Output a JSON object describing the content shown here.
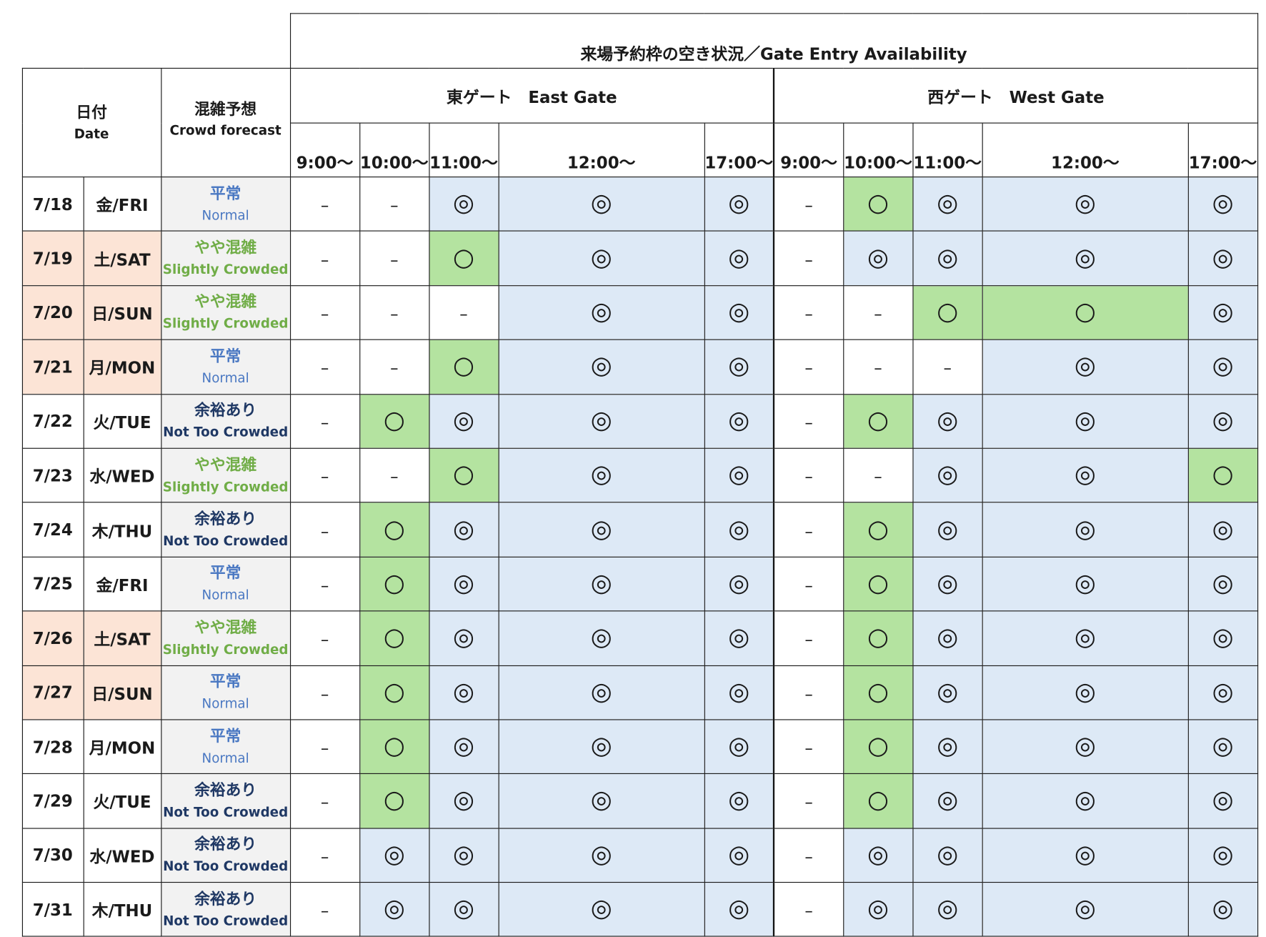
{
  "title": "来場予約枠の空き状況／Gate Entry Availability",
  "header": {
    "date_jp": "日付",
    "date_en": "Date",
    "forecast_jp": "混雑予想",
    "forecast_en": "Crowd forecast"
  },
  "gates": [
    {
      "label": "東ゲート　East Gate",
      "times": [
        "9:00〜",
        "10:00〜",
        "11:00〜",
        "12:00〜",
        "17:00〜"
      ]
    },
    {
      "label": "西ゲート　West Gate",
      "times": [
        "9:00〜",
        "10:00〜",
        "11:00〜",
        "12:00〜",
        "17:00〜"
      ]
    }
  ],
  "forecast_levels": {
    "normal": {
      "jp": "平常",
      "en": "Normal",
      "color": "#4a78c2"
    },
    "slightly": {
      "jp": "やや混雑",
      "en": "Slightly Crowded",
      "color": "#70ad47"
    },
    "notcrowded": {
      "jp": "余裕あり",
      "en": "Not Too Crowded",
      "color": "#1f3864"
    }
  },
  "symbols": {
    "available": {
      "mark": "◎",
      "bg": "#dde9f6"
    },
    "limited": {
      "mark": "○",
      "bg": "#b4e3a0"
    },
    "none": {
      "mark": "–",
      "bg": "#ffffff"
    }
  },
  "weekend_bg": "#fce4d6",
  "rows": [
    {
      "date": "7/18",
      "day": "金/FRI",
      "weekend": false,
      "forecast": "normal",
      "east": [
        "none",
        "none",
        "available",
        "available",
        "available"
      ],
      "west": [
        "none",
        "limited",
        "available",
        "available",
        "available"
      ]
    },
    {
      "date": "7/19",
      "day": "土/SAT",
      "weekend": true,
      "forecast": "slightly",
      "east": [
        "none",
        "none",
        "limited",
        "available",
        "available"
      ],
      "west": [
        "none",
        "available",
        "available",
        "available",
        "available"
      ]
    },
    {
      "date": "7/20",
      "day": "日/SUN",
      "weekend": true,
      "forecast": "slightly",
      "east": [
        "none",
        "none",
        "none",
        "available",
        "available"
      ],
      "west": [
        "none",
        "none",
        "limited",
        "limited",
        "available"
      ]
    },
    {
      "date": "7/21",
      "day": "月/MON",
      "weekend": true,
      "forecast": "normal",
      "east": [
        "none",
        "none",
        "limited",
        "available",
        "available"
      ],
      "west": [
        "none",
        "none",
        "none",
        "available",
        "available"
      ]
    },
    {
      "date": "7/22",
      "day": "火/TUE",
      "weekend": false,
      "forecast": "notcrowded",
      "east": [
        "none",
        "limited",
        "available",
        "available",
        "available"
      ],
      "west": [
        "none",
        "limited",
        "available",
        "available",
        "available"
      ]
    },
    {
      "date": "7/23",
      "day": "水/WED",
      "weekend": false,
      "forecast": "slightly",
      "east": [
        "none",
        "none",
        "limited",
        "available",
        "available"
      ],
      "west": [
        "none",
        "none",
        "available",
        "available",
        "limited"
      ]
    },
    {
      "date": "7/24",
      "day": "木/THU",
      "weekend": false,
      "forecast": "notcrowded",
      "east": [
        "none",
        "limited",
        "available",
        "available",
        "available"
      ],
      "west": [
        "none",
        "limited",
        "available",
        "available",
        "available"
      ]
    },
    {
      "date": "7/25",
      "day": "金/FRI",
      "weekend": false,
      "forecast": "normal",
      "east": [
        "none",
        "limited",
        "available",
        "available",
        "available"
      ],
      "west": [
        "none",
        "limited",
        "available",
        "available",
        "available"
      ]
    },
    {
      "date": "7/26",
      "day": "土/SAT",
      "weekend": true,
      "forecast": "slightly",
      "east": [
        "none",
        "limited",
        "available",
        "available",
        "available"
      ],
      "west": [
        "none",
        "limited",
        "available",
        "available",
        "available"
      ]
    },
    {
      "date": "7/27",
      "day": "日/SUN",
      "weekend": true,
      "forecast": "normal",
      "east": [
        "none",
        "limited",
        "available",
        "available",
        "available"
      ],
      "west": [
        "none",
        "limited",
        "available",
        "available",
        "available"
      ]
    },
    {
      "date": "7/28",
      "day": "月/MON",
      "weekend": false,
      "forecast": "normal",
      "east": [
        "none",
        "limited",
        "available",
        "available",
        "available"
      ],
      "west": [
        "none",
        "limited",
        "available",
        "available",
        "available"
      ]
    },
    {
      "date": "7/29",
      "day": "火/TUE",
      "weekend": false,
      "forecast": "notcrowded",
      "east": [
        "none",
        "limited",
        "available",
        "available",
        "available"
      ],
      "west": [
        "none",
        "limited",
        "available",
        "available",
        "available"
      ]
    },
    {
      "date": "7/30",
      "day": "水/WED",
      "weekend": false,
      "forecast": "notcrowded",
      "east": [
        "none",
        "available",
        "available",
        "available",
        "available"
      ],
      "west": [
        "none",
        "available",
        "available",
        "available",
        "available"
      ]
    },
    {
      "date": "7/31",
      "day": "木/THU",
      "weekend": false,
      "forecast": "notcrowded",
      "east": [
        "none",
        "available",
        "available",
        "available",
        "available"
      ],
      "west": [
        "none",
        "available",
        "available",
        "available",
        "available"
      ]
    }
  ]
}
